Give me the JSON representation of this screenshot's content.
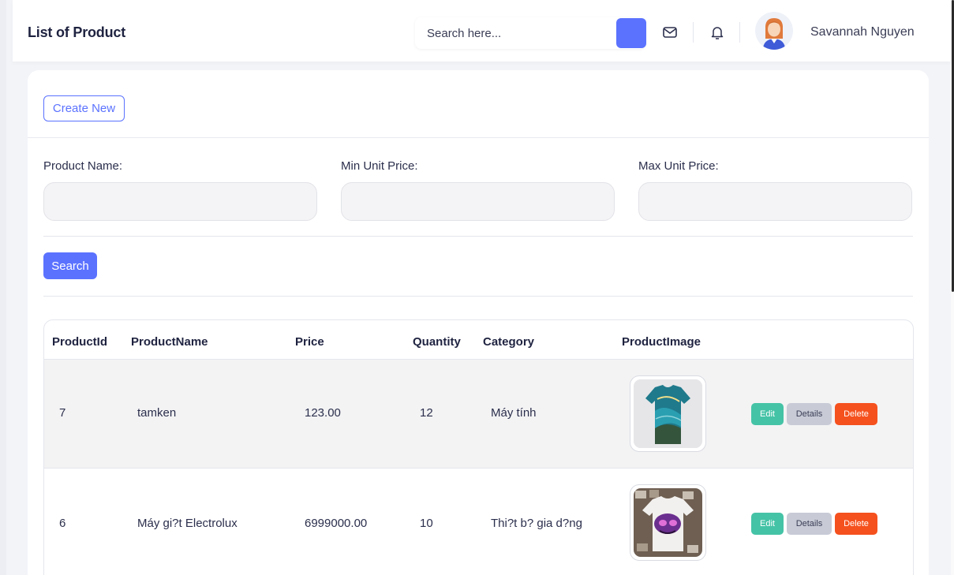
{
  "header": {
    "title": "List of Product",
    "search_placeholder": "Search here...",
    "user_name": "Savannah Nguyen"
  },
  "toolbar": {
    "create_label": "Create New"
  },
  "filters": {
    "product_name_label": "Product Name:",
    "min_price_label": "Min Unit Price:",
    "max_price_label": "Max Unit Price:",
    "search_label": "Search"
  },
  "table": {
    "columns": [
      "ProductId",
      "ProductName",
      "Price",
      "Quantity",
      "Category",
      "ProductImage"
    ],
    "rows": [
      {
        "id": "7",
        "name": "tamken",
        "price": "123.00",
        "quantity": "12",
        "category": "Máy tính",
        "image": "tshirt-swirl"
      },
      {
        "id": "6",
        "name": "Máy gi?t Electrolux",
        "price": "6999000.00",
        "quantity": "10",
        "category": "Thi?t b? gia d?ng",
        "image": "tshirt-print"
      }
    ],
    "actions": {
      "edit": "Edit",
      "details": "Details",
      "delete": "Delete"
    }
  },
  "colors": {
    "primary": "#5b72ff",
    "edit": "#45c3a6",
    "details": "#c8cbd6",
    "delete": "#f5511e"
  }
}
